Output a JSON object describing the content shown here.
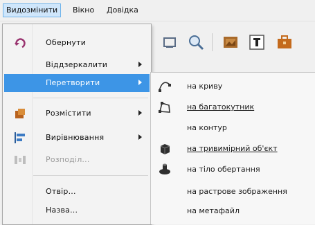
{
  "menubar": {
    "items": [
      {
        "label": "Видозмінити",
        "active": true
      },
      {
        "label": "Вікно",
        "active": false
      },
      {
        "label": "Довідка",
        "active": false
      }
    ]
  },
  "toolbar": {
    "icons": [
      "frame-icon",
      "zoom-icon",
      "image-icon",
      "text-icon",
      "briefcase-icon"
    ]
  },
  "dropdown": {
    "items": [
      {
        "label": "Обернути",
        "icon": "rotate-icon",
        "submenu": false,
        "disabled": false
      },
      {
        "label": "Віддзеркалити",
        "icon": null,
        "submenu": true,
        "disabled": false
      },
      {
        "label": "Перетворити",
        "icon": null,
        "submenu": true,
        "disabled": false,
        "highlighted": true
      },
      {
        "label": "Розмістити",
        "icon": "arrange-icon",
        "submenu": true,
        "disabled": false
      },
      {
        "label": "Вирівнювання",
        "icon": "align-icon",
        "submenu": true,
        "disabled": false
      },
      {
        "label": "Розподіл...",
        "icon": "distribute-icon",
        "submenu": false,
        "disabled": true
      },
      {
        "label": "Отвір...",
        "icon": null,
        "submenu": false,
        "disabled": false
      },
      {
        "label": "Назва...",
        "icon": null,
        "submenu": false,
        "disabled": false
      }
    ]
  },
  "submenu": {
    "items": [
      {
        "label": "на криву",
        "icon": "curve-icon"
      },
      {
        "label": "на багатокутник",
        "icon": "polygon-icon"
      },
      {
        "label": "на контур",
        "icon": null
      },
      {
        "label": "на тривимірний об'єкт",
        "icon": "cube-3d-icon"
      },
      {
        "label": "на тіло обертання",
        "icon": "rotation-body-icon"
      },
      {
        "label": "на растрове зображення",
        "icon": null
      },
      {
        "label": "на метафайл",
        "icon": null
      }
    ]
  },
  "colors": {
    "highlight": "#3d95e6",
    "menubar_active": "#cfe6fb",
    "disabled_text": "#9a9a9a"
  }
}
